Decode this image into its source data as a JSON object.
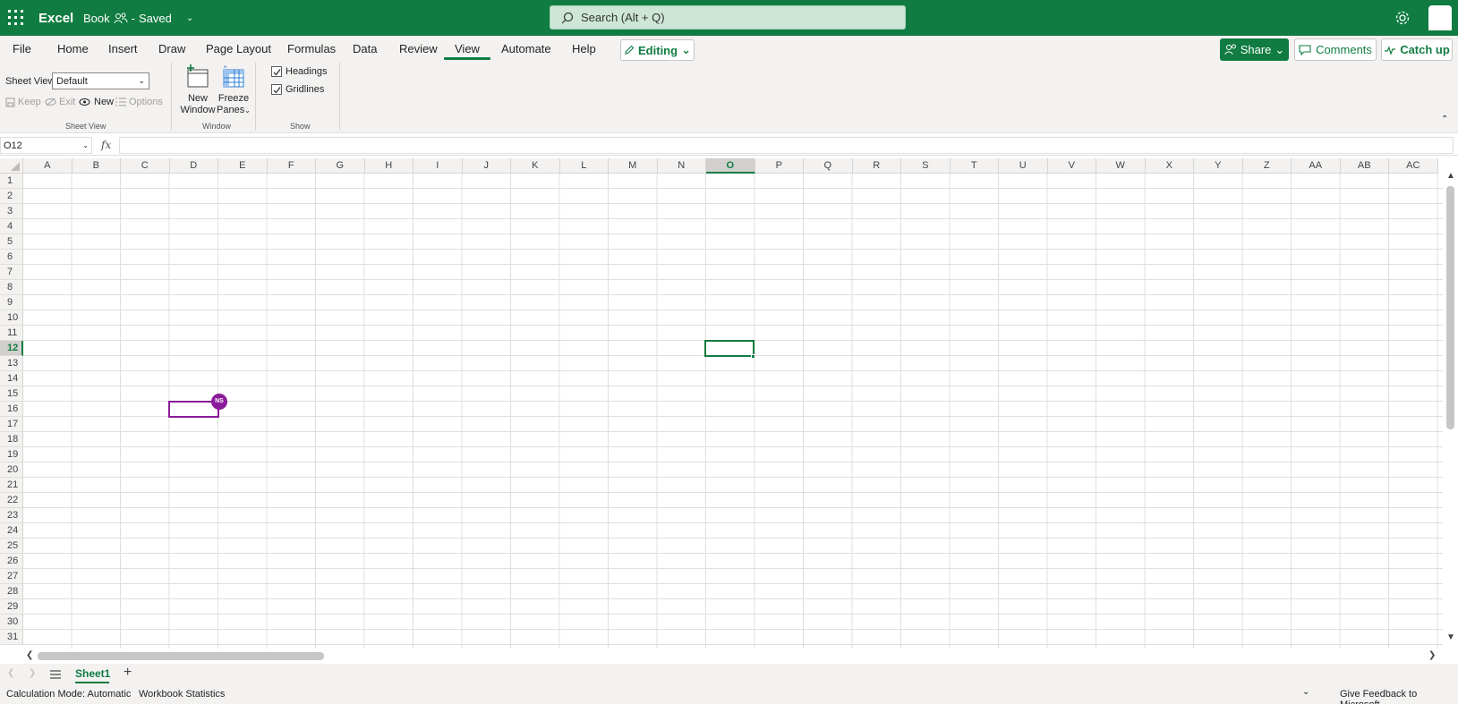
{
  "titlebar": {
    "app_name": "Excel",
    "doc_name": "Book",
    "save_status": "Saved",
    "search_placeholder": "Search (Alt + Q)"
  },
  "menu": {
    "tabs": [
      "File",
      "Home",
      "Insert",
      "Draw",
      "Page Layout",
      "Formulas",
      "Data",
      "Review",
      "View",
      "Automate",
      "Help"
    ],
    "active_tab": "View",
    "editing_label": "Editing",
    "share_label": "Share",
    "comments_label": "Comments",
    "catchup_label": "Catch up"
  },
  "ribbon": {
    "sheet_view": {
      "label": "Sheet View",
      "select_value": "Default",
      "keep_label": "Keep",
      "exit_label": "Exit",
      "new_label": "New",
      "options_label": "Options",
      "group_name": "Sheet View"
    },
    "window": {
      "new_window_line1": "New",
      "new_window_line2": "Window",
      "freeze_line1": "Freeze",
      "freeze_line2": "Panes",
      "group_name": "Window"
    },
    "show": {
      "headings_label": "Headings",
      "gridlines_label": "Gridlines",
      "group_name": "Show"
    }
  },
  "formula_bar": {
    "name_box": "O12",
    "fx_label": "fx",
    "value": ""
  },
  "grid": {
    "columns": [
      "A",
      "B",
      "C",
      "D",
      "E",
      "F",
      "G",
      "H",
      "I",
      "J",
      "K",
      "L",
      "M",
      "N",
      "O",
      "P",
      "Q",
      "R",
      "S",
      "T",
      "U",
      "V",
      "W",
      "X",
      "Y",
      "Z",
      "AA",
      "AB",
      "AC"
    ],
    "rows": [
      "1",
      "2",
      "3",
      "4",
      "5",
      "6",
      "7",
      "8",
      "9",
      "10",
      "11",
      "12",
      "13",
      "14",
      "15",
      "16",
      "17",
      "18",
      "19",
      "20",
      "21",
      "22",
      "23",
      "24",
      "25",
      "26",
      "27",
      "28",
      "29",
      "30",
      "31"
    ],
    "selected_column": "O",
    "selected_row": "12",
    "collaborator_initials": "NS"
  },
  "sheets": {
    "tabs": [
      "Sheet1"
    ],
    "active": "Sheet1"
  },
  "status": {
    "calc_mode": "Calculation Mode: Automatic",
    "workbook_stats": "Workbook Statistics",
    "feedback": "Give Feedback to Microsoft"
  },
  "colors": {
    "brand": "#107c41",
    "collaborator": "#8a1b99"
  }
}
